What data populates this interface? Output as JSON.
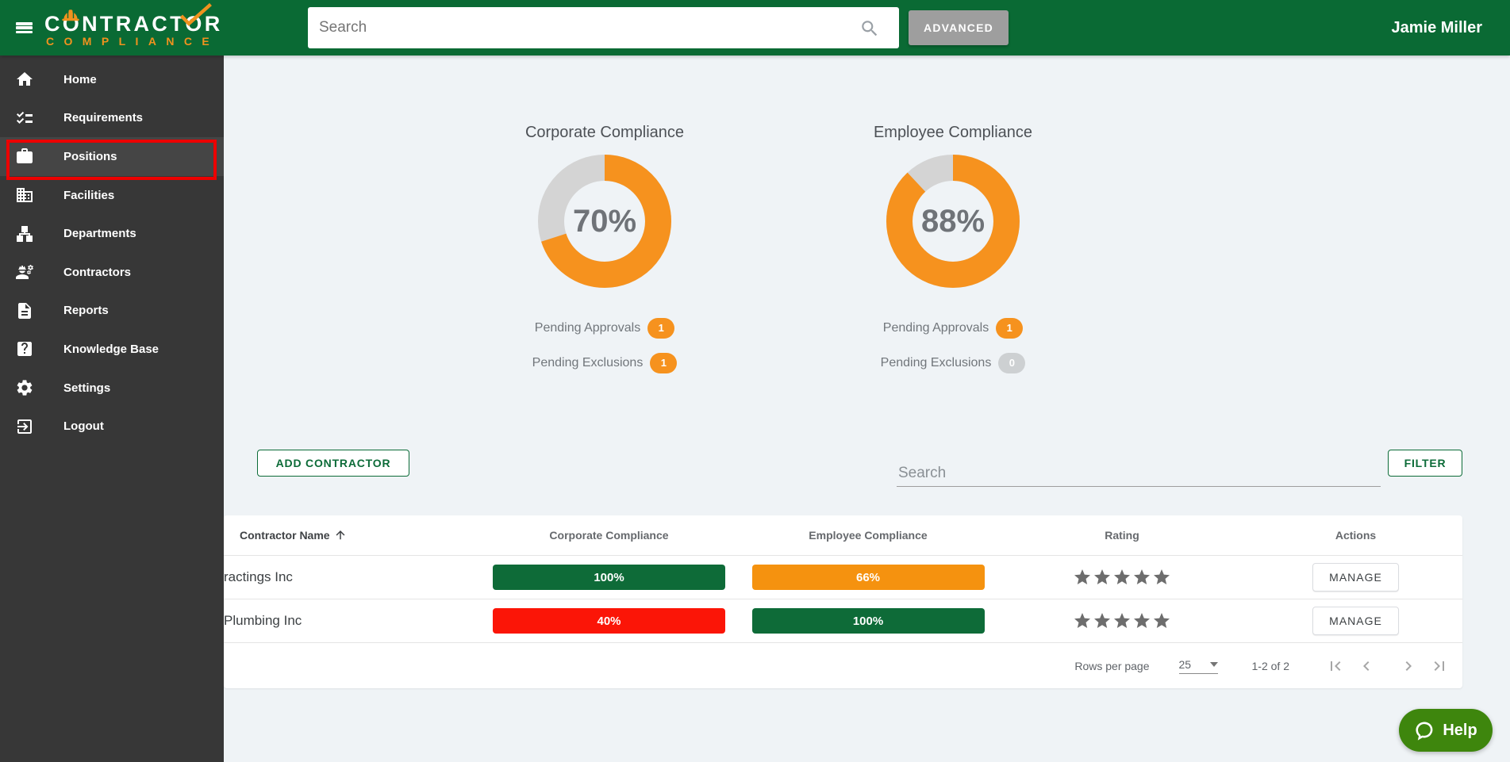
{
  "header": {
    "logo_line1": "CONTRACTOR",
    "logo_line2": "COMPLIANCE",
    "search_placeholder": "Search",
    "advanced_label": "ADVANCED",
    "user_name": "Jamie Miller"
  },
  "sidebar": {
    "items": [
      {
        "label": "Home"
      },
      {
        "label": "Requirements"
      },
      {
        "label": "Positions",
        "selected": true
      },
      {
        "label": "Facilities"
      },
      {
        "label": "Departments"
      },
      {
        "label": "Contractors"
      },
      {
        "label": "Reports"
      },
      {
        "label": "Knowledge Base"
      },
      {
        "label": "Settings"
      },
      {
        "label": "Logout"
      }
    ]
  },
  "chart_data": [
    {
      "type": "donut",
      "title": "Corporate Compliance",
      "percent": 70,
      "percent_label": "70%",
      "pending_approvals_label": "Pending Approvals",
      "pending_approvals_value": "1",
      "pending_approvals_color": "#f6921e",
      "pending_exclusions_label": "Pending Exclusions",
      "pending_exclusions_value": "1",
      "pending_exclusions_color": "#f6921e",
      "arc_color": "#f6921e",
      "track_color": "#d4d4d4"
    },
    {
      "type": "donut",
      "title": "Employee Compliance",
      "percent": 88,
      "percent_label": "88%",
      "pending_approvals_label": "Pending Approvals",
      "pending_approvals_value": "1",
      "pending_approvals_color": "#f6921e",
      "pending_exclusions_label": "Pending Exclusions",
      "pending_exclusions_value": "0",
      "pending_exclusions_color": "#cdd0d2",
      "arc_color": "#f6921e",
      "track_color": "#d4d4d4"
    }
  ],
  "toolbar": {
    "add_contractor_label": "ADD CONTRACTOR",
    "search_placeholder": "Search",
    "filter_label": "FILTER"
  },
  "table": {
    "columns": {
      "name": "Contractor Name",
      "corporate": "Corporate Compliance",
      "employee": "Employee Compliance",
      "rating": "Rating",
      "actions": "Actions"
    },
    "rows": [
      {
        "name": "ractings Inc",
        "corporate_label": "100%",
        "corporate_color": "#0e6b38",
        "employee_label": "66%",
        "employee_color": "#f5920f",
        "rating": 5,
        "action_label": "MANAGE"
      },
      {
        "name": "Plumbing Inc",
        "corporate_label": "40%",
        "corporate_color": "#fb1507",
        "employee_label": "100%",
        "employee_color": "#0e6b38",
        "rating": 5,
        "action_label": "MANAGE"
      }
    ],
    "pagination": {
      "rows_per_page_label": "Rows per page",
      "rows_per_page_value": "25",
      "range_label": "1-2 of 2"
    }
  },
  "help": {
    "label": "Help"
  }
}
